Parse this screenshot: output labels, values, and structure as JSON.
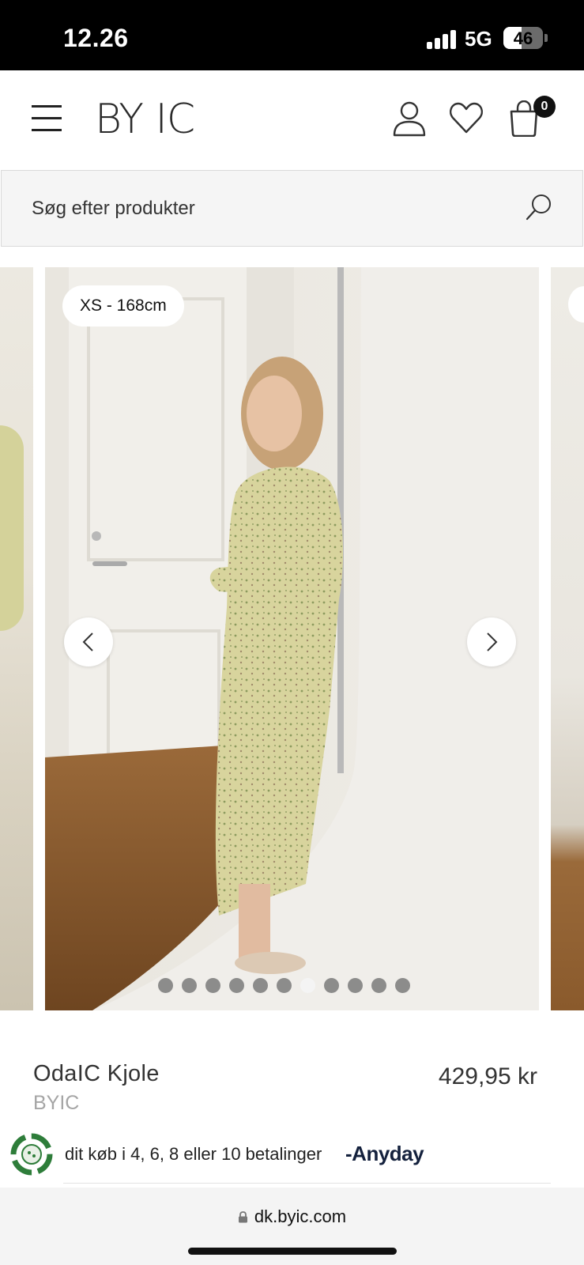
{
  "status_bar": {
    "time": "12.26",
    "network": "5G",
    "battery": "46",
    "battery_level": 0.46
  },
  "header": {
    "logo": "BY IC",
    "cart_count": "0",
    "icons": [
      "menu-icon",
      "account-icon",
      "heart-icon",
      "cart-icon"
    ]
  },
  "search": {
    "placeholder": "Søg efter produkter"
  },
  "gallery": {
    "size_label": "XS - 168cm",
    "total_images": 11,
    "active_index": 6
  },
  "product": {
    "name": "OdaIC Kjole",
    "brand": "BYIC",
    "price": "429,95 kr"
  },
  "payment": {
    "text": "dit køb i 4, 6, 8 eller 10 betalinger",
    "provider": "Anyday"
  },
  "browser": {
    "url": "dk.byic.com"
  },
  "colors": {
    "dress": "#d6d39a",
    "badge": "#111111"
  }
}
